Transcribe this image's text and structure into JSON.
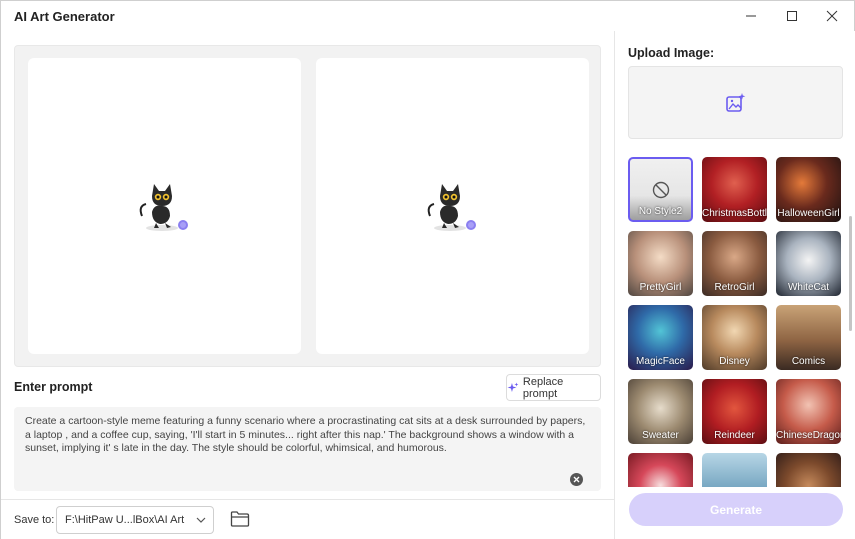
{
  "window": {
    "title": "AI Art Generator"
  },
  "preview": {
    "cards": [
      {
        "icon": "cat-mascot-icon"
      },
      {
        "icon": "cat-mascot-icon"
      }
    ]
  },
  "prompt": {
    "title": "Enter prompt",
    "replace_label": "Replace prompt",
    "text": "Create a cartoon-style meme featuring a funny scenario where a procrastinating cat sits at a desk surrounded by papers, a laptop , and a coffee cup, saying, 'I'll start in 5 minutes... right after this nap.' The background shows a window with a sunset, implying it' s late in the day. The style should be colorful, whimsical, and humorous."
  },
  "save": {
    "label": "Save to:",
    "path": "F:\\HitPaw U...lBox\\AI Art"
  },
  "upload": {
    "title": "Upload Image:",
    "icon": "add-image-icon"
  },
  "styles": [
    {
      "label": "No Style2",
      "selected": true
    },
    {
      "label": "ChristmasBottle",
      "selected": false
    },
    {
      "label": "HalloweenGirl",
      "selected": false
    },
    {
      "label": "PrettyGirl",
      "selected": false
    },
    {
      "label": "RetroGirl",
      "selected": false
    },
    {
      "label": "WhiteCat",
      "selected": false
    },
    {
      "label": "MagicFace",
      "selected": false
    },
    {
      "label": "Disney",
      "selected": false
    },
    {
      "label": "Comics",
      "selected": false
    },
    {
      "label": "Sweater",
      "selected": false
    },
    {
      "label": "Reindeer",
      "selected": false
    },
    {
      "label": "ChineseDragon",
      "selected": false
    },
    {
      "label": "",
      "selected": false
    },
    {
      "label": "",
      "selected": false
    },
    {
      "label": "",
      "selected": false
    }
  ],
  "generate": {
    "label": "Generate"
  },
  "colors": {
    "accent": "#6b5cf0",
    "generate_disabled": "#d7d0fb"
  }
}
